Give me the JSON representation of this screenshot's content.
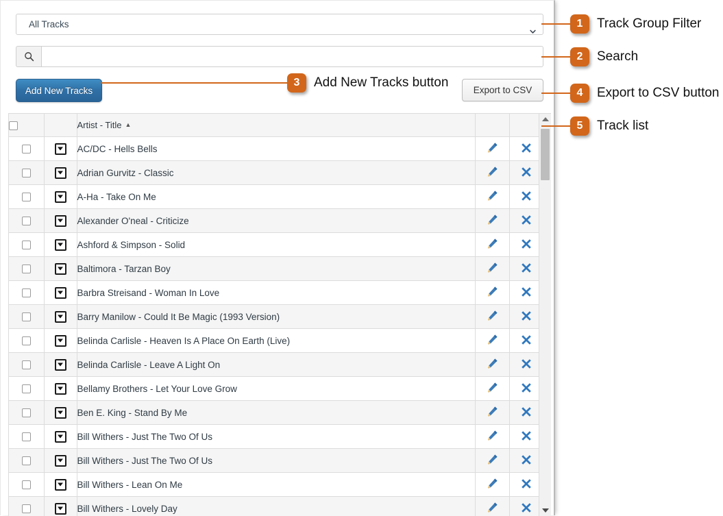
{
  "filter": {
    "selected": "All Tracks",
    "options": [
      "All Tracks"
    ]
  },
  "search": {
    "value": "",
    "placeholder": "",
    "icon": "search-icon"
  },
  "buttons": {
    "add_new_tracks": "Add New Tracks",
    "export_csv": "Export to CSV"
  },
  "table": {
    "columns": [
      "",
      "",
      "Artist - Title",
      "",
      ""
    ],
    "sort_column": "Artist - Title",
    "sort_direction": "▲",
    "row_icons": {
      "dropdown": "chevron-down-box-icon",
      "edit": "pencil-icon",
      "delete": "x-cross-icon"
    },
    "rows": [
      {
        "title": "AC/DC - Hells Bells"
      },
      {
        "title": "Adrian Gurvitz - Classic"
      },
      {
        "title": "A-Ha - Take On Me"
      },
      {
        "title": "Alexander O'neal - Criticize"
      },
      {
        "title": "Ashford & Simpson - Solid"
      },
      {
        "title": "Baltimora - Tarzan Boy"
      },
      {
        "title": "Barbra Streisand - Woman In Love"
      },
      {
        "title": "Barry Manilow - Could It Be Magic (1993 Version)"
      },
      {
        "title": "Belinda Carlisle - Heaven Is A Place On Earth (Live)"
      },
      {
        "title": "Belinda Carlisle - Leave A Light On"
      },
      {
        "title": "Bellamy Brothers - Let Your Love Grow"
      },
      {
        "title": "Ben E. King - Stand By Me"
      },
      {
        "title": "Bill Withers - Just The Two Of Us"
      },
      {
        "title": "Bill Withers - Just The Two Of Us"
      },
      {
        "title": "Bill Withers - Lean On Me"
      },
      {
        "title": "Bill Withers - Lovely Day"
      }
    ]
  },
  "callouts": [
    {
      "number": "1",
      "label": "Track Group Filter"
    },
    {
      "number": "2",
      "label": "Search"
    },
    {
      "number": "3",
      "label": "Add New Tracks button"
    },
    {
      "number": "4",
      "label": "Export to CSV button"
    },
    {
      "number": "5",
      "label": "Track list"
    }
  ],
  "colors": {
    "callout_accent": "#d2661a",
    "primary_button": "#2f6fa5",
    "icon_edit": "#3d7cb8",
    "icon_delete": "#2f78bf"
  }
}
